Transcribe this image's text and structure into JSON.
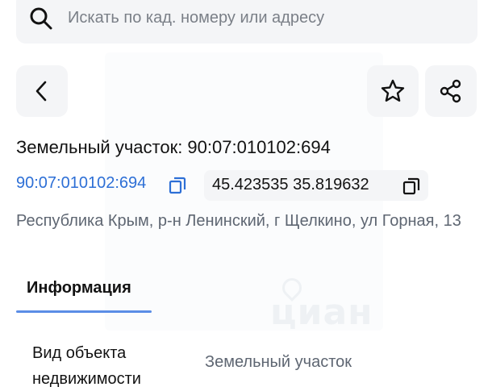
{
  "search": {
    "placeholder": "Искать по кад. номеру или адресу"
  },
  "header": {
    "icons": {
      "back": "chevron-left-icon",
      "favorite": "star-icon",
      "share": "share-icon"
    }
  },
  "object": {
    "title": "Земельный участок: 90:07:010102:694",
    "cadastral_number": "90:07:010102:694",
    "coordinates": "45.423535 35.819632",
    "address": "Республика Крым, р-н Ленинский, г Щелкино, ул Горная, 13"
  },
  "tabs": [
    {
      "label": "Информация",
      "active": true
    }
  ],
  "info_rows": [
    {
      "label": "Вид объекта недвижимости",
      "value": "Земельный участок"
    }
  ],
  "colors": {
    "accent": "#2d6fd6",
    "tab_underline": "#5b8de6",
    "chip_bg": "#f4f5f7",
    "muted_text": "#5e6672"
  }
}
